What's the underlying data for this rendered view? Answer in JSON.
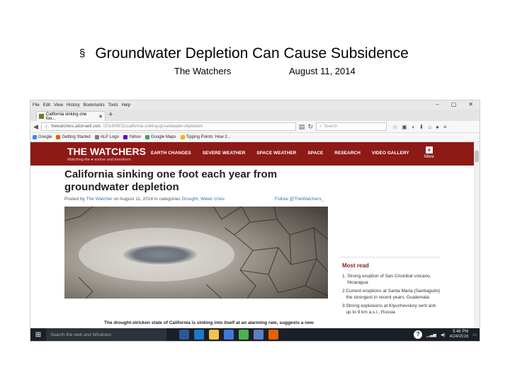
{
  "slide": {
    "bullet": "§",
    "title": "Groundwater Depletion Can Cause Subsidence",
    "source": "The Watchers",
    "date": "August 11, 2014"
  },
  "browser": {
    "menu": [
      "File",
      "Edit",
      "View",
      "History",
      "Bookmarks",
      "Tools",
      "Help"
    ],
    "tab_title": "California sinking one foo...",
    "url_domain": "thewatchers.adorraeli.com",
    "url_path": "/2014/08/11/california-sinking-groundwater-depletion/",
    "search_placeholder": "Search",
    "bookmarks": [
      {
        "label": "Google",
        "color": "#4285f4"
      },
      {
        "label": "Getting Started",
        "color": "#e66000"
      },
      {
        "label": "ALP Logo",
        "color": "#7a7a7a"
      },
      {
        "label": "Yahoo",
        "color": "#5f01d1"
      },
      {
        "label": "Google Maps",
        "color": "#34a853"
      },
      {
        "label": "Tipping Points: How 2...",
        "color": "#f0b400"
      }
    ]
  },
  "site": {
    "logo": "THE WATCHERS",
    "tagline": "Watching the ● evolve and transform",
    "nav": [
      "EARTH CHANGES",
      "SEVERE WEATHER",
      "SPACE WEATHER",
      "SPACE",
      "RESEARCH",
      "VIDEO GALLERY"
    ],
    "more": "More"
  },
  "article": {
    "title": "California sinking one foot each year from groundwater depletion",
    "posted_by": "Posted by",
    "author": "The Watcher",
    "posted_on": "on August 11, 2014 in categories",
    "categories": "Drought, Water crisis",
    "follow": "Follow @TheWatchers_",
    "lead": "The drought-stricken state of California is sinking into itself at an alarming rate, suggests a new"
  },
  "sidebar": {
    "heading": "Most read",
    "items": [
      {
        "num": "1.",
        "text": "Strong eruption of San Cristobal volcano, Nicaragua"
      },
      {
        "num": "2.",
        "text": "Current eruptions at Santa Maria (Santiaguito) the strongest in recent years, Guatemala"
      },
      {
        "num": "3.",
        "text": "Strong explosions at Klyuchevskoy sent ash up to 9 km a.s.l., Russia"
      }
    ]
  },
  "taskbar": {
    "search_placeholder": "Search the web and Windows",
    "time": "9:46 PM",
    "date": "4/24/2016",
    "help": "?"
  }
}
